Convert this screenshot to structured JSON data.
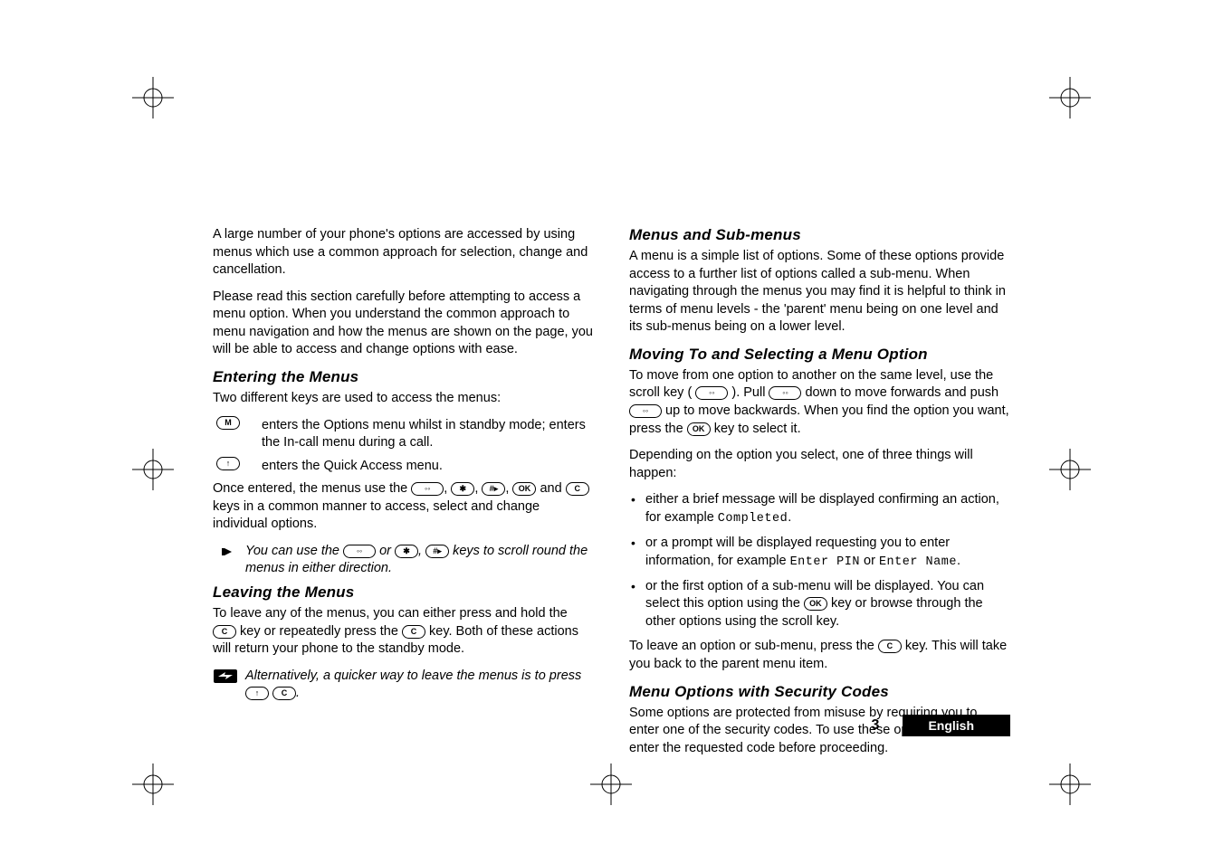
{
  "left": {
    "intro1": "A large number of your phone's options are accessed by using menus which use a common approach for selection, change and cancellation.",
    "intro2": "Please read this section carefully before attempting to access a menu option. When you understand the common approach to menu navigation and how the menus are shown on the page, you will be able to access and change options with ease.",
    "h_enter": "Entering the Menus",
    "enter_intro": "Two different keys are used to access the menus:",
    "keyM_desc": "enters the Options menu whilst in standby mode; enters the In-call menu during a call.",
    "keyUp_desc": "enters the Quick Access menu.",
    "once_pre": "Once entered, the menus use the ",
    "once_mid": " and ",
    "once_post": " keys in a common manner to access, select and change individual options.",
    "tip_pre": "You can use the ",
    "tip_mid": " or ",
    "tip_post": " keys to scroll round the menus in either direction.",
    "h_leave": "Leaving the Menus",
    "leave_pre": "To leave any of the menus, you can either press and hold the ",
    "leave_mid": " key or repeatedly press the ",
    "leave_post": " key. Both of these actions will return your phone to the standby mode.",
    "alt": "Alternatively, a quicker way to leave the menus is to press "
  },
  "right": {
    "h_sub": "Menus and Sub-menus",
    "sub_body": "A menu is a simple list of options. Some of these options provide access to a further list of options called a sub-menu. When navigating through the menus you may find it is helpful to think in terms of menu levels - the 'parent' menu being on one level and its sub-menus being on a lower level.",
    "h_move": "Moving To and Selecting a Menu Option",
    "move1_pre": "To move from one option to another on the same level, use the scroll key (",
    "move1_mid1": "). Pull ",
    "move1_mid2": " down to move forwards and push ",
    "move1_mid3": " up to move backwards. When you find the option you want, press the ",
    "move1_post": " key to select it.",
    "move2": "Depending on the option you select, one of three things will happen:",
    "bul1_pre": "either a brief message will be displayed confirming an action, for example ",
    "bul1_lcd": "Completed",
    "bul2_pre": "or a prompt will be displayed requesting you to enter information, for example ",
    "bul2_lcd1": "Enter PIN",
    "bul2_or": " or ",
    "bul2_lcd2": "Enter Name",
    "bul3_pre": "or the first option of a sub-menu will be displayed. You can select this option using the ",
    "bul3_post": " key or browse through the other options using the scroll key.",
    "leaveopt_pre": "To leave an option or sub-menu, press the ",
    "leaveopt_post": " key. This will take you back to the parent menu item.",
    "h_sec": "Menu Options with Security Codes",
    "sec_body": "Some options are protected from misuse by requiring you to enter one of the security codes. To use these options, you must enter the requested code before proceeding."
  },
  "keys": {
    "m": "M",
    "up": "↑",
    "c": "C",
    "ok": "OK",
    "star": "✱",
    "hash": "#▸",
    "scroll": "◦◦"
  },
  "footer": {
    "page": "3",
    "lang": "English"
  }
}
